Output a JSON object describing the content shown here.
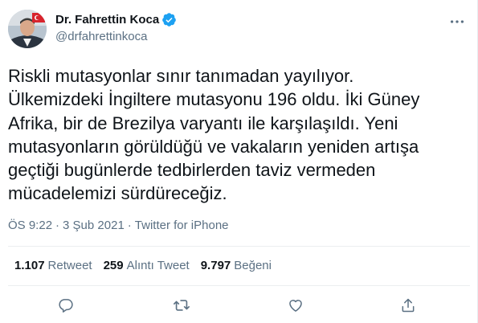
{
  "author": {
    "display_name": "Dr. Fahrettin Koca",
    "handle": "@drfahrettinkoca",
    "verified": true
  },
  "tweet": {
    "text": "Riskli mutasyonlar sınır tanımadan yayılıyor.\nÜlkemizdeki İngiltere mutasyonu 196 oldu. İki Güney\nAfrika, bir de Brezilya varyantı ile karşılaşıldı. Yeni\nmutasyonların görüldüğü ve vakaların yeniden artışa\ngeçtiği bugünlerde tedbirlerden taviz vermeden\nmücadelemizi sürdüreceğiz."
  },
  "meta": {
    "time": "ÖS 9:22",
    "separator": "·",
    "date": "3 Şub 2021",
    "source": "Twitter for iPhone"
  },
  "stats": {
    "retweets": {
      "count": "1.107",
      "label": "Retweet"
    },
    "quotes": {
      "count": "259",
      "label": "Alıntı Tweet"
    },
    "likes": {
      "count": "9.797",
      "label": "Beğeni"
    }
  },
  "icons": {
    "verified": "verified-badge-icon",
    "more": "more-icon",
    "reply": "reply-icon",
    "retweet": "retweet-icon",
    "like": "like-icon",
    "share": "share-icon"
  },
  "colors": {
    "text": "#0f1419",
    "secondary": "#5b7083",
    "verified": "#1da1f2",
    "divider": "#ebeef0"
  }
}
